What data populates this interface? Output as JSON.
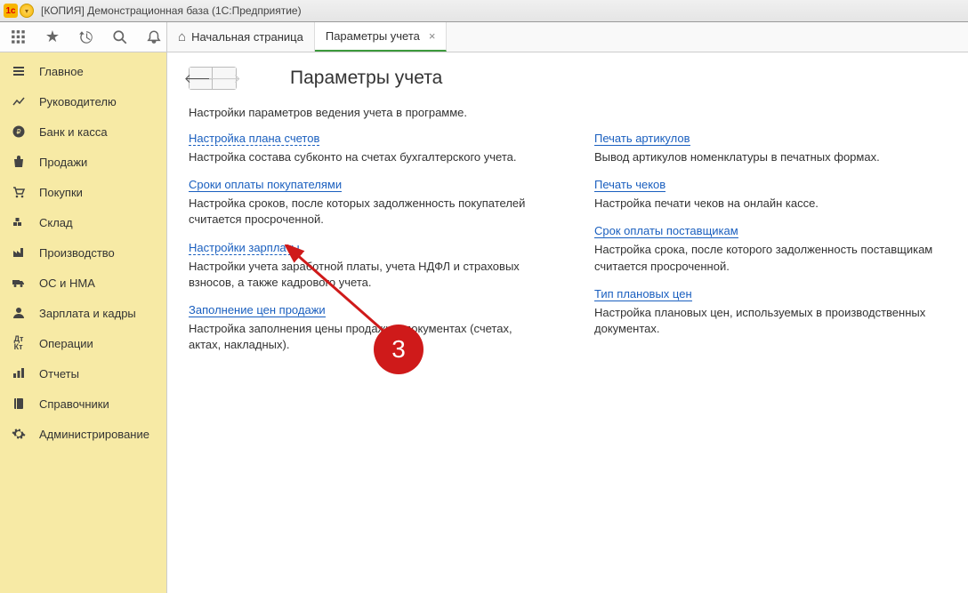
{
  "titlebar": {
    "app_icon_text": "1с",
    "title": "[КОПИЯ] Демонстрационная база  (1С:Предприятие)"
  },
  "toolbar": {
    "icons": [
      "apps-icon",
      "star-icon",
      "history-icon",
      "search-icon",
      "bell-icon"
    ]
  },
  "tabs": [
    {
      "label": "Начальная страница",
      "has_close": false,
      "is_home": true,
      "active": false
    },
    {
      "label": "Параметры учета",
      "has_close": true,
      "is_home": false,
      "active": true
    }
  ],
  "sidebar": {
    "items": [
      {
        "icon": "menu-icon",
        "label": "Главное"
      },
      {
        "icon": "chart-icon",
        "label": "Руководителю"
      },
      {
        "icon": "ruble-icon",
        "label": "Банк и касса"
      },
      {
        "icon": "bag-icon",
        "label": "Продажи"
      },
      {
        "icon": "cart-icon",
        "label": "Покупки"
      },
      {
        "icon": "warehouse-icon",
        "label": "Склад"
      },
      {
        "icon": "factory-icon",
        "label": "Производство"
      },
      {
        "icon": "truck-icon",
        "label": "ОС и НМА"
      },
      {
        "icon": "person-icon",
        "label": "Зарплата и кадры"
      },
      {
        "icon": "dtkt-icon",
        "label": "Операции"
      },
      {
        "icon": "bar-icon",
        "label": "Отчеты"
      },
      {
        "icon": "book-icon",
        "label": "Справочники"
      },
      {
        "icon": "gear-icon",
        "label": "Администрирование"
      }
    ]
  },
  "page": {
    "title": "Параметры учета",
    "intro": "Настройки параметров ведения учета в программе.",
    "col1": [
      {
        "link": "Настройка плана счетов",
        "dotted": true,
        "desc": "Настройка состава субконто на счетах бухгалтерского учета."
      },
      {
        "link": "Сроки оплаты покупателями",
        "dotted": false,
        "desc": "Настройка сроков, после которых задолженность покупателей считается просроченной."
      },
      {
        "link": "Настройки зарплаты",
        "dotted": true,
        "desc": "Настройки учета заработной платы, учета НДФЛ и страховых взносов, а также кадрового учета."
      },
      {
        "link": "Заполнение цен продажи",
        "dotted": false,
        "desc": "Настройка заполнения цены продажи в документах (счетах, актах, накладных)."
      }
    ],
    "col2": [
      {
        "link": "Печать артикулов",
        "dotted": false,
        "desc": "Вывод артикулов номенклатуры в печатных формах."
      },
      {
        "link": "Печать чеков",
        "dotted": false,
        "desc": "Настройка печати чеков на онлайн кассе."
      },
      {
        "link": "Срок оплаты поставщикам",
        "dotted": false,
        "desc": "Настройка срока, после которого задолженность поставщикам считается просроченной."
      },
      {
        "link": "Тип плановых цен",
        "dotted": false,
        "desc": "Настройка плановых цен, используемых в производственных документах."
      }
    ]
  },
  "annotation": {
    "number": "3"
  }
}
